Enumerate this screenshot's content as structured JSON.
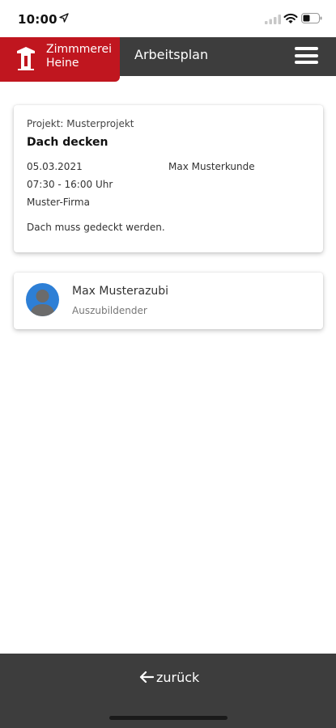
{
  "status_bar": {
    "time": "10:00",
    "icons": [
      "location-arrow-icon",
      "signal-icon",
      "wifi-icon",
      "battery-icon"
    ]
  },
  "header": {
    "brand_line1": "Zimmmerei",
    "brand_line2": "Heine",
    "title": "Arbeitsplan",
    "menu_icon": "hamburger-menu-icon",
    "colors": {
      "brand": "#c0161f",
      "bar": "#3d3d3d"
    }
  },
  "project_card": {
    "project": "Projekt: Musterprojekt",
    "title": "Dach decken",
    "date": "05.03.2021",
    "customer": "Max Musterkunde",
    "time": "07:30 - 16:00 Uhr",
    "company": "Muster-Firma",
    "description": "Dach muss gedeckt werden."
  },
  "person_card": {
    "name": "Max Musterazubi",
    "role": "Auszubildender",
    "avatar_color": "#2d7fd6"
  },
  "footer": {
    "back_label": "zurück",
    "back_icon": "arrow-left-icon"
  }
}
